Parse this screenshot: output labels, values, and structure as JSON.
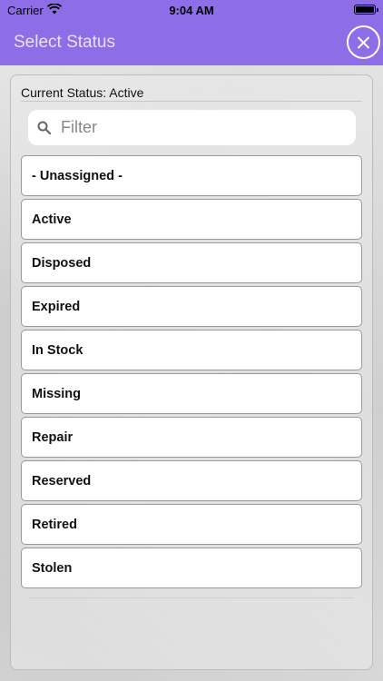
{
  "status_bar": {
    "carrier": "Carrier",
    "time": "9:04 AM"
  },
  "nav": {
    "title": "Select Status",
    "close_icon": "close-circle-icon"
  },
  "current_status": "Current Status: Active",
  "filter": {
    "placeholder": "Filter",
    "value": ""
  },
  "statuses": [
    "- Unassigned -",
    "Active",
    "Disposed",
    "Expired",
    "In Stock",
    "Missing",
    "Repair",
    "Reserved",
    "Retired",
    "Stolen"
  ],
  "colors": {
    "accent": "#8e6ee6"
  }
}
